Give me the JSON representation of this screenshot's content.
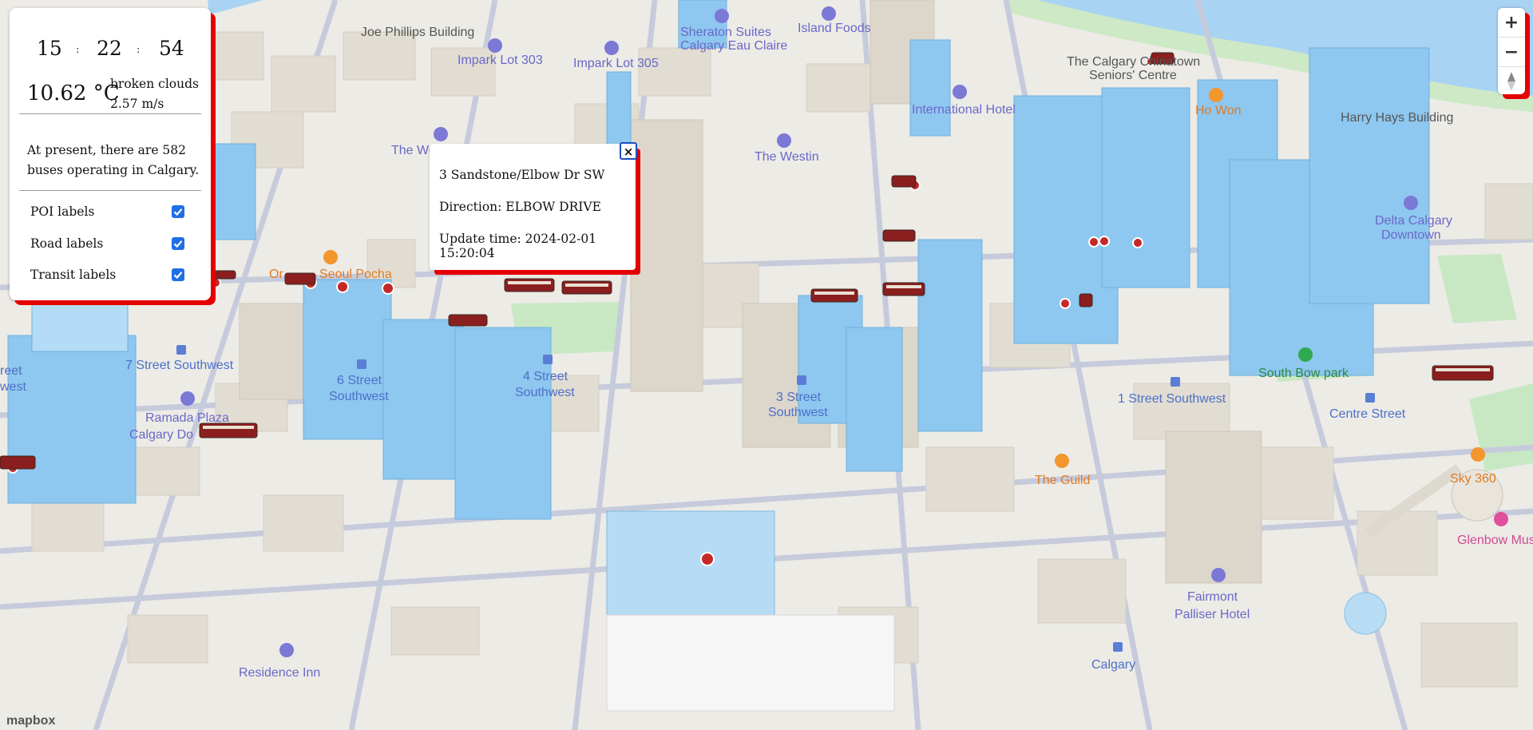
{
  "clock": {
    "hours": "15",
    "minutes": "22",
    "seconds": "54",
    "separator": ":"
  },
  "weather": {
    "temperature": "10.62 °C",
    "condition": "broken clouds",
    "wind": "2.57 m/s"
  },
  "summary": "At present, there are 582 buses operating in Calgary.",
  "layers": [
    {
      "label": "POI labels",
      "checked": true
    },
    {
      "label": "Road labels",
      "checked": true
    },
    {
      "label": "Transit labels",
      "checked": true
    }
  ],
  "popup": {
    "stop": "3 Sandstone/Elbow Dr SW",
    "direction": "Direction: ELBOW DRIVE",
    "update_time": "Update time: 2024-02-01 15:20:04",
    "close_symbol": "×"
  },
  "zoom": {
    "in_symbol": "+",
    "out_symbol": "−"
  },
  "attribution": "mapbox",
  "map_labels": {
    "joe_phillips": "Joe Phillips Building",
    "impark_303": "Impark Lot 303",
    "impark_305": "Impark Lot 305",
    "sheraton_1": "Sheraton Suites",
    "sheraton_2": "Calgary Eau Claire",
    "island_foods": "Island Foods",
    "chinatown_1": "The Calgary Chinatown",
    "chinatown_2": "Seniors' Centre",
    "international_hotel": "International Hotel",
    "ho_won": "Ho Won",
    "harry_hays": "Harry Hays Building",
    "the_we": "The We",
    "the_westin": "The Westin",
    "delta_1": "Delta Calgary",
    "delta_2": "Downtown",
    "seoul_pocha": "Seoul Pocha",
    "or": "Or",
    "st7": "7 Street Southwest",
    "st6_1": "6 Street",
    "st6_2": "Southwest",
    "st4_1": "4 Street",
    "st4_2": "Southwest",
    "st3_1": "3 Street",
    "st3_2": "Southwest",
    "st1": "1 Street Southwest",
    "south_bow": "South Bow park",
    "centre_street": "Centre Street",
    "reet": "reet",
    "west": "west",
    "ramada_1": "Ramada Plaza",
    "ramada_2": "Calgary Do",
    "the_guild": "The Guild",
    "sky_360": "Sky 360",
    "glenbow": "Glenbow Muse",
    "fairmont_1": "Fairmont",
    "fairmont_2": "Palliser Hotel",
    "residence_inn": "Residence Inn",
    "calgary": "Calgary"
  },
  "colors": {
    "accent_red": "#e40000",
    "checkbox_blue": "#1f6fe5",
    "river": "#a9d3f2",
    "park": "#c8e8c4",
    "building_blue": "#7fc0ec",
    "poi_blue": "#7b78d6",
    "poi_orange": "#f2962e",
    "bus_dot": "#c62828"
  }
}
